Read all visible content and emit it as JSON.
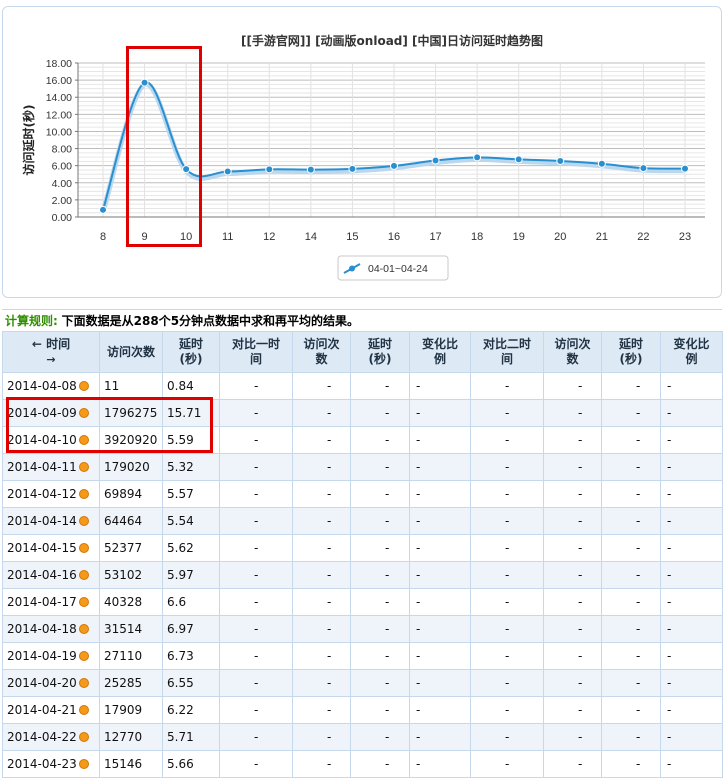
{
  "chart_data": {
    "type": "line",
    "title": "[[手游官网]] [动画版onload] [中国]日访问延时趋势图",
    "xlabel": "",
    "ylabel": "访问延时(秒)",
    "ylim": [
      0,
      18
    ],
    "yticks": [
      "0.00",
      "2.00",
      "4.00",
      "6.00",
      "8.00",
      "10.00",
      "12.00",
      "14.00",
      "16.00",
      "18.00"
    ],
    "categories": [
      "8",
      "9",
      "10",
      "11",
      "12",
      "14",
      "15",
      "16",
      "17",
      "18",
      "19",
      "20",
      "21",
      "22",
      "23"
    ],
    "series": [
      {
        "name": "04-01~04-24",
        "values": [
          0.84,
          15.71,
          5.59,
          5.32,
          5.57,
          5.54,
          5.62,
          5.97,
          6.6,
          6.97,
          6.73,
          6.55,
          6.22,
          5.71,
          5.66
        ]
      }
    ],
    "grid": true,
    "legend": "bottom-center",
    "colors": {
      "line": "#2a8fcf",
      "marker": "#2a8fcf",
      "grid": "#d5d5d5",
      "axis": "#777777"
    }
  },
  "rule": {
    "label": "计算规则:",
    "text": "下面数据是从288个5分钟点数据中求和再平均的结果。"
  },
  "table": {
    "headers": [
      {
        "line1": "← 时间",
        "line2": "→"
      },
      {
        "line1": "访问次数",
        "line2": ""
      },
      {
        "line1": "延时",
        "line2": "(秒)"
      },
      {
        "line1": "对比一时",
        "line2": "间"
      },
      {
        "line1": "访问次",
        "line2": "数"
      },
      {
        "line1": "延时",
        "line2": "(秒)"
      },
      {
        "line1": "变化比",
        "line2": "例"
      },
      {
        "line1": "对比二时",
        "line2": "间"
      },
      {
        "line1": "访问次",
        "line2": "数"
      },
      {
        "line1": "延时",
        "line2": "(秒)"
      },
      {
        "line1": "变化比",
        "line2": "例"
      }
    ],
    "rows": [
      {
        "date": "2014-04-08",
        "visits": "11",
        "delay": "0.84",
        "rest": [
          "-",
          "-",
          "-",
          "-",
          "-",
          "-",
          "-",
          "-"
        ]
      },
      {
        "date": "2014-04-09",
        "visits": "1796275",
        "delay": "15.71",
        "rest": [
          "-",
          "-",
          "-",
          "-",
          "-",
          "-",
          "-",
          "-"
        ]
      },
      {
        "date": "2014-04-10",
        "visits": "3920920",
        "delay": "5.59",
        "rest": [
          "-",
          "-",
          "-",
          "-",
          "-",
          "-",
          "-",
          "-"
        ]
      },
      {
        "date": "2014-04-11",
        "visits": "179020",
        "delay": "5.32",
        "rest": [
          "-",
          "-",
          "-",
          "-",
          "-",
          "-",
          "-",
          "-"
        ]
      },
      {
        "date": "2014-04-12",
        "visits": "69894",
        "delay": "5.57",
        "rest": [
          "-",
          "-",
          "-",
          "-",
          "-",
          "-",
          "-",
          "-"
        ]
      },
      {
        "date": "2014-04-14",
        "visits": "64464",
        "delay": "5.54",
        "rest": [
          "-",
          "-",
          "-",
          "-",
          "-",
          "-",
          "-",
          "-"
        ]
      },
      {
        "date": "2014-04-15",
        "visits": "52377",
        "delay": "5.62",
        "rest": [
          "-",
          "-",
          "-",
          "-",
          "-",
          "-",
          "-",
          "-"
        ]
      },
      {
        "date": "2014-04-16",
        "visits": "53102",
        "delay": "5.97",
        "rest": [
          "-",
          "-",
          "-",
          "-",
          "-",
          "-",
          "-",
          "-"
        ]
      },
      {
        "date": "2014-04-17",
        "visits": "40328",
        "delay": "6.6",
        "rest": [
          "-",
          "-",
          "-",
          "-",
          "-",
          "-",
          "-",
          "-"
        ]
      },
      {
        "date": "2014-04-18",
        "visits": "31514",
        "delay": "6.97",
        "rest": [
          "-",
          "-",
          "-",
          "-",
          "-",
          "-",
          "-",
          "-"
        ]
      },
      {
        "date": "2014-04-19",
        "visits": "27110",
        "delay": "6.73",
        "rest": [
          "-",
          "-",
          "-",
          "-",
          "-",
          "-",
          "-",
          "-"
        ]
      },
      {
        "date": "2014-04-20",
        "visits": "25285",
        "delay": "6.55",
        "rest": [
          "-",
          "-",
          "-",
          "-",
          "-",
          "-",
          "-",
          "-"
        ]
      },
      {
        "date": "2014-04-21",
        "visits": "17909",
        "delay": "6.22",
        "rest": [
          "-",
          "-",
          "-",
          "-",
          "-",
          "-",
          "-",
          "-"
        ]
      },
      {
        "date": "2014-04-22",
        "visits": "12770",
        "delay": "5.71",
        "rest": [
          "-",
          "-",
          "-",
          "-",
          "-",
          "-",
          "-",
          "-"
        ]
      },
      {
        "date": "2014-04-23",
        "visits": "15146",
        "delay": "5.66",
        "rest": [
          "-",
          "-",
          "-",
          "-",
          "-",
          "-",
          "-",
          "-"
        ]
      }
    ],
    "date_icon": "orange-dot-icon"
  },
  "colors": {
    "highlight": "#e00000",
    "header_bg": "#dde9f5",
    "border": "#c6d9ec",
    "rule_label": "#2f8f00",
    "row_alt": "#eef4fa"
  }
}
